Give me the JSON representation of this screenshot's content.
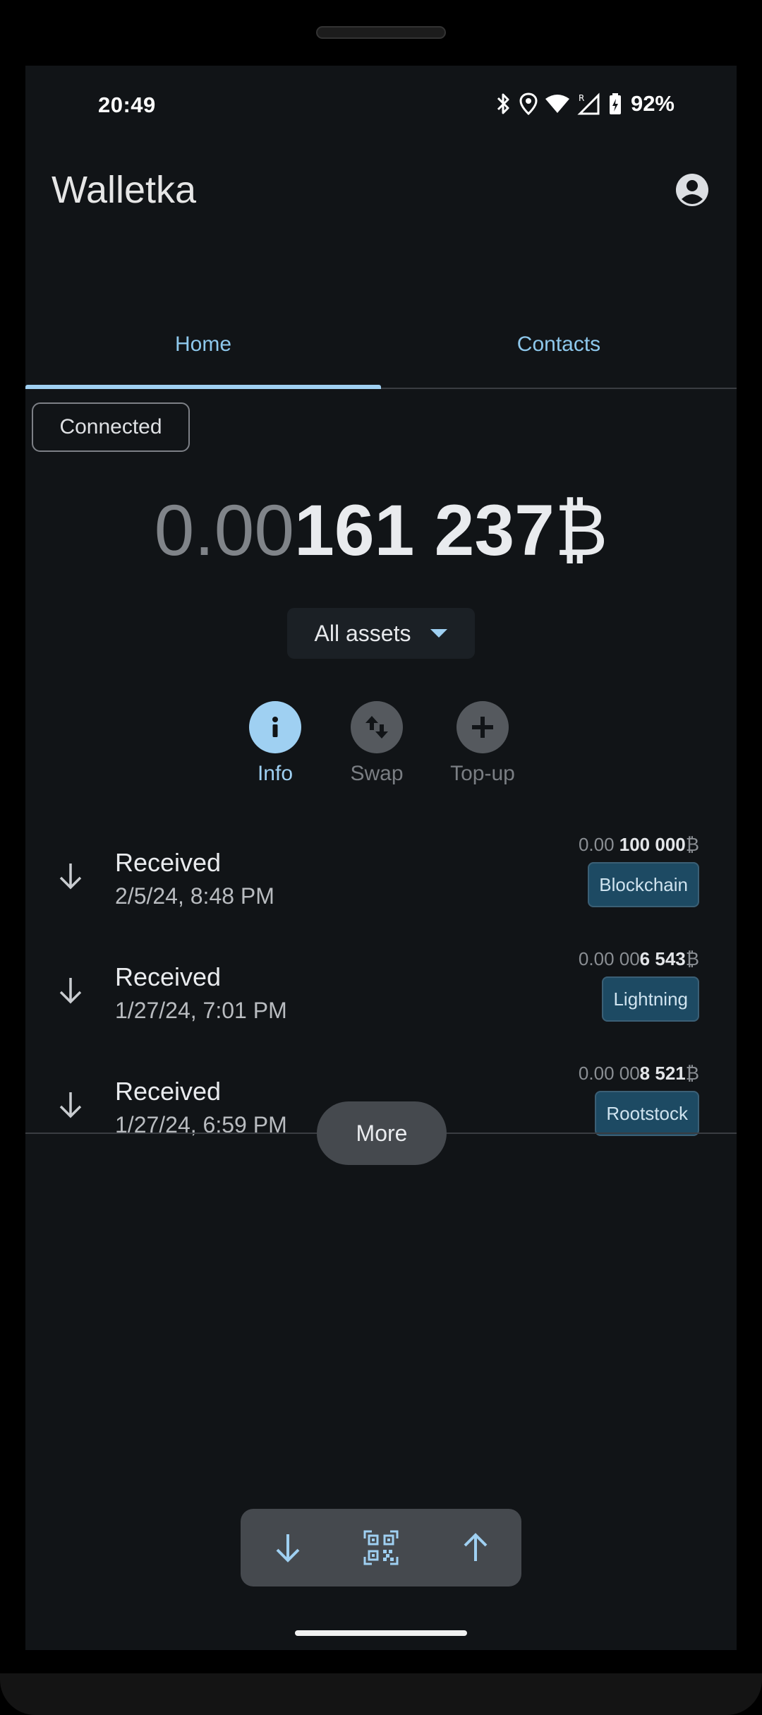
{
  "status_bar": {
    "time": "20:49",
    "battery": "92%",
    "icons": [
      "bluetooth-icon",
      "location-icon",
      "wifi-icon",
      "signal-roaming-icon",
      "battery-charging-icon"
    ]
  },
  "app": {
    "title": "Walletka",
    "account_icon": "account-circle-icon"
  },
  "tabs": [
    {
      "label": "Home",
      "active": true
    },
    {
      "label": "Contacts",
      "active": false
    }
  ],
  "connection": {
    "label": "Connected"
  },
  "balance": {
    "dim": "0.00",
    "bright": "161 237",
    "symbol": "₿"
  },
  "assets": {
    "label": "All assets"
  },
  "actions": [
    {
      "label": "Info",
      "icon": "info-icon",
      "active": true
    },
    {
      "label": "Swap",
      "icon": "swap-icon",
      "active": false
    },
    {
      "label": "Top-up",
      "icon": "plus-icon",
      "active": false
    }
  ],
  "transactions": [
    {
      "title": "Received",
      "date": "2/5/24, 8:48 PM",
      "amount_dim": "0.00 ",
      "amount_bold": "100 000",
      "symbol": "₿",
      "network": "Blockchain"
    },
    {
      "title": "Received",
      "date": "1/27/24, 7:01 PM",
      "amount_dim": "0.00 00",
      "amount_bold": "6 543",
      "symbol": "₿",
      "network": "Lightning"
    },
    {
      "title": "Received",
      "date": "1/27/24, 6:59 PM",
      "amount_dim": "0.00 00",
      "amount_bold": "8 521",
      "symbol": "₿",
      "network": "Rootstock"
    }
  ],
  "more": {
    "label": "More"
  },
  "bottom_bar": {
    "icons": [
      "arrow-down-icon",
      "qr-code-scan-icon",
      "arrow-up-icon"
    ]
  },
  "colors": {
    "background": "#111417",
    "accent": "#9fd0f2",
    "badge": "#1d4a63",
    "surface": "#45494e"
  }
}
